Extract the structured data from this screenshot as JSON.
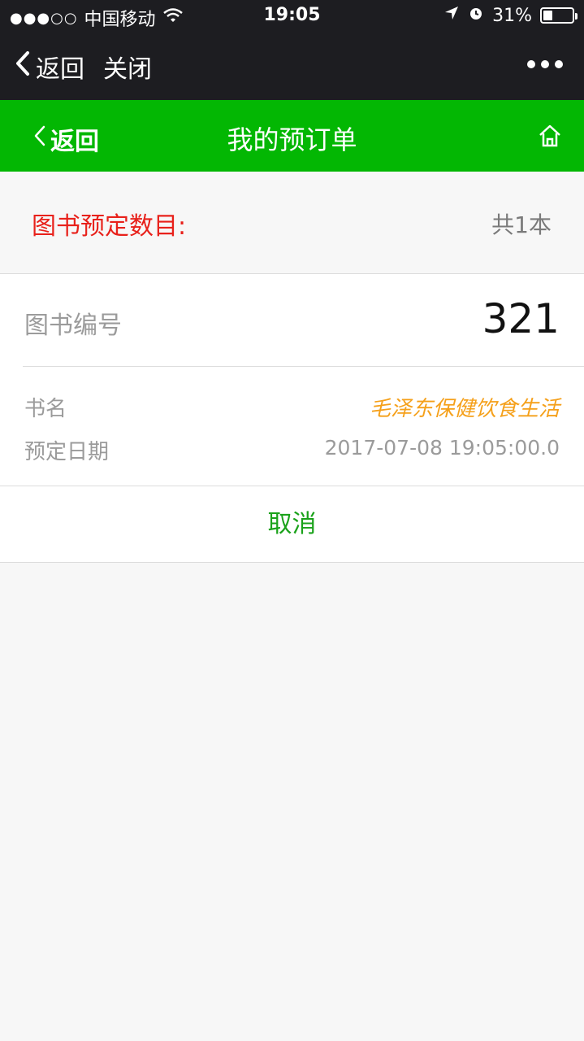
{
  "status_bar": {
    "signal": "●●●○○",
    "carrier": "中国移动",
    "time": "19:05",
    "battery": "31%",
    "battery_level": 0.31
  },
  "wechat_nav": {
    "back_label": "返回",
    "close_label": "关闭",
    "more_icon": "more-dots-icon"
  },
  "app_header": {
    "back_label": "返回",
    "title": "我的预订单",
    "home_icon": "home-icon",
    "color": "#03b703"
  },
  "summary": {
    "label": "图书预定数目:",
    "count": "共1本",
    "label_color": "#e8211b"
  },
  "order": {
    "book_id_label": "图书编号",
    "book_id": "321",
    "title_label": "书名",
    "title": "毛泽东保健饮食生活",
    "date_label": "预定日期",
    "date": "2017-07-08 19:05:00.0"
  },
  "actions": {
    "cancel_label": "取消"
  }
}
